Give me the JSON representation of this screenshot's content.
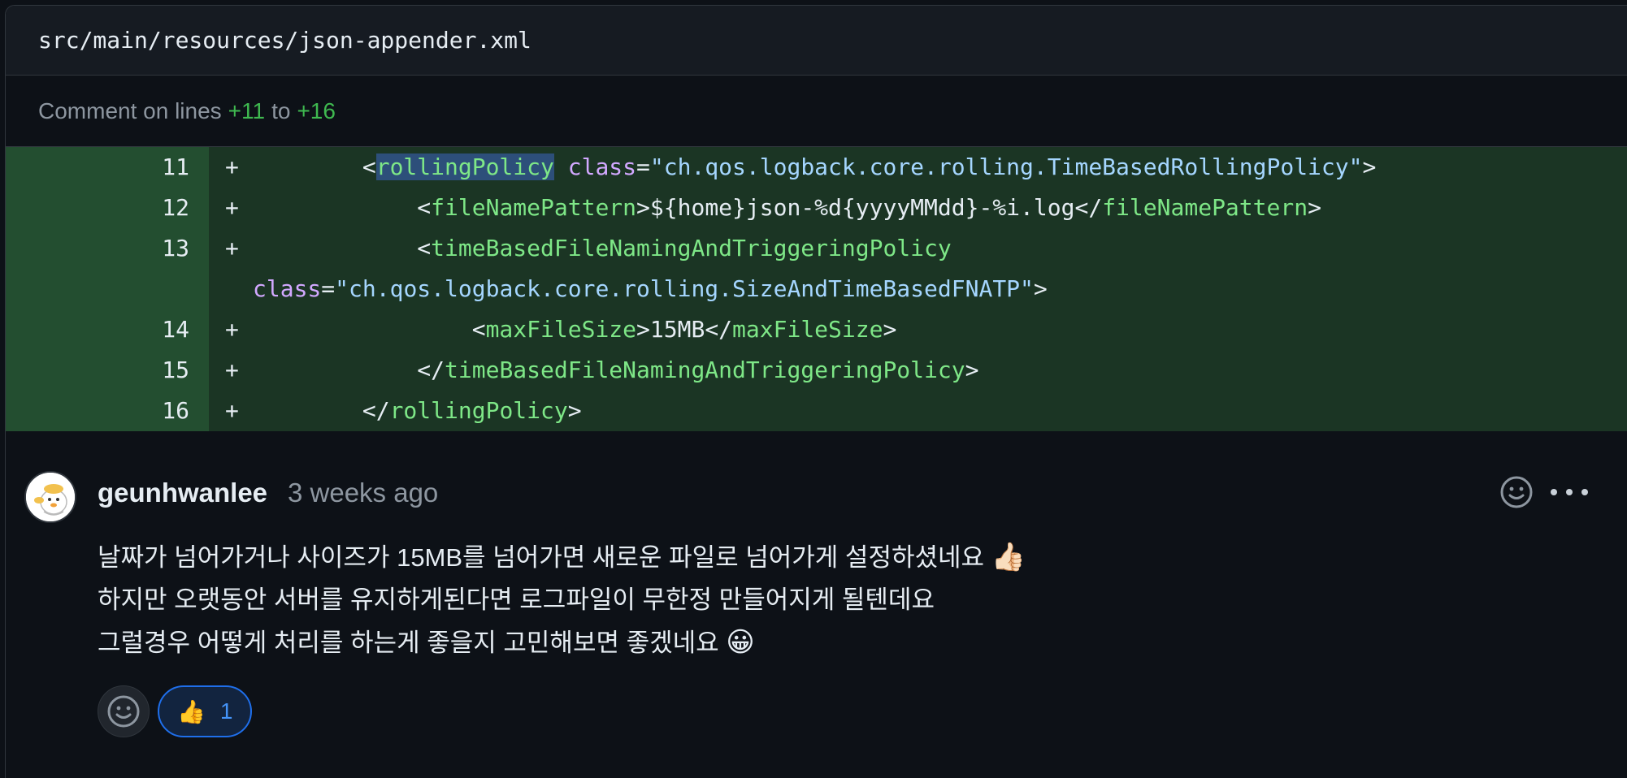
{
  "file": {
    "path": "src/main/resources/json-appender.xml"
  },
  "comment_on": {
    "prefix": "Comment on lines",
    "start": "+11",
    "joiner": "to",
    "end": "+16"
  },
  "diff": {
    "line_numbers": [
      "11",
      "12",
      "13",
      "14",
      "15",
      "16"
    ],
    "plus": "+",
    "lines": [
      {
        "indent": "        ",
        "lt": "<",
        "tag": "rollingPolicy",
        "attr": "class",
        "eq": "=",
        "val": "\"ch.qos.logback.core.rolling.TimeBasedRollingPolicy\"",
        "gt": ">"
      },
      {
        "indent": "            ",
        "lt": "<",
        "tag": "fileNamePattern",
        "gt": ">",
        "text": "${home}json-%d{yyyyMMdd}-%i.log",
        "close_lt": "</",
        "close_tag": "fileNamePattern",
        "close_gt": ">"
      },
      {
        "indent": "            ",
        "lt": "<",
        "tag": "timeBasedFileNamingAndTriggeringPolicy"
      },
      {
        "attr": "class",
        "eq": "=",
        "val": "\"ch.qos.logback.core.rolling.SizeAndTimeBasedFNATP\"",
        "gt": ">"
      },
      {
        "indent": "                ",
        "lt": "<",
        "tag": "maxFileSize",
        "gt": ">",
        "text": "15MB",
        "close_lt": "</",
        "close_tag": "maxFileSize",
        "close_gt": ">"
      },
      {
        "indent": "            ",
        "lt": "</",
        "tag": "timeBasedFileNamingAndTriggeringPolicy",
        "gt": ">"
      },
      {
        "indent": "        ",
        "lt": "</",
        "tag": "rollingPolicy",
        "gt": ">"
      }
    ]
  },
  "comment": {
    "author": "geunhwanlee",
    "time": "3 weeks ago",
    "body": [
      {
        "text": "날짜가 넘어가거나 사이즈가 15MB를 넘어가면 새로운 파일로 넘어가게 설정하셨네요 ",
        "emoji": "👍🏻"
      },
      {
        "text": "하지만 오랫동안 서버를 유지하게된다면 로그파일이 무한정 만들어지게 될텐데요",
        "emoji": ""
      },
      {
        "text": "그럴경우 어떻게 처리를 하는게 좋을지 고민해보면 좋겠네요 ",
        "emoji": "😀"
      }
    ],
    "reactions": [
      {
        "emoji": "👍",
        "count": "1"
      }
    ]
  },
  "colors": {
    "added_bg": "#1b3524",
    "added_gutter": "#234e30",
    "tag": "#7ee787",
    "attr": "#d2a8ff",
    "string": "#a5d6ff",
    "accent": "#1f6feb"
  },
  "icons": [
    "smiley-icon",
    "kebab-horizontal-icon",
    "avatar-image"
  ]
}
